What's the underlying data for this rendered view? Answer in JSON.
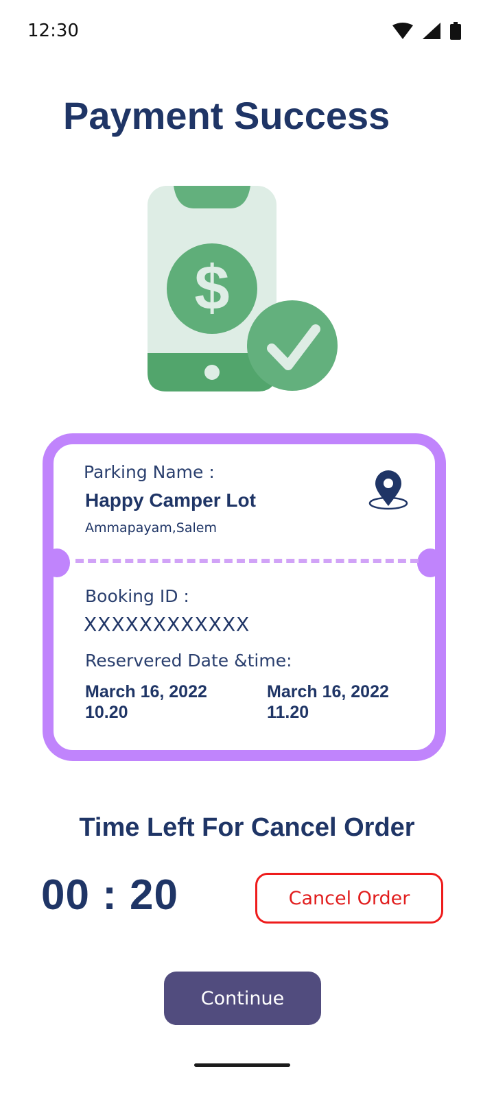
{
  "status_bar": {
    "time": "12:30",
    "icons": [
      "wifi-icon",
      "signal-icon",
      "battery-icon"
    ]
  },
  "page": {
    "title": "Payment Success",
    "illustration": "phone-payment-success-icon"
  },
  "ticket": {
    "parking_label": "Parking Name :",
    "parking_name": "Happy Camper Lot",
    "location": "Ammapayam,Salem",
    "location_icon": "map-pin-icon",
    "booking_label": "Booking ID :",
    "booking_id": "XXXXXXXXXXXX",
    "reserved_label": "Reservered Date &time:",
    "start_date": "March 16, 2022",
    "start_time": "10.20",
    "end_date": "March 16, 2022",
    "end_time": "11.20"
  },
  "cancel": {
    "heading": "Time Left For Cancel Order",
    "countdown": "00 : 20",
    "button_label": "Cancel Order"
  },
  "footer": {
    "continue_label": "Continue"
  },
  "colors": {
    "primary_text": "#1f3566",
    "ticket_border": "#c084fc",
    "cancel_red": "#ee1c1c",
    "continue_bg": "#514c7e",
    "success_green": "#5fae79"
  }
}
